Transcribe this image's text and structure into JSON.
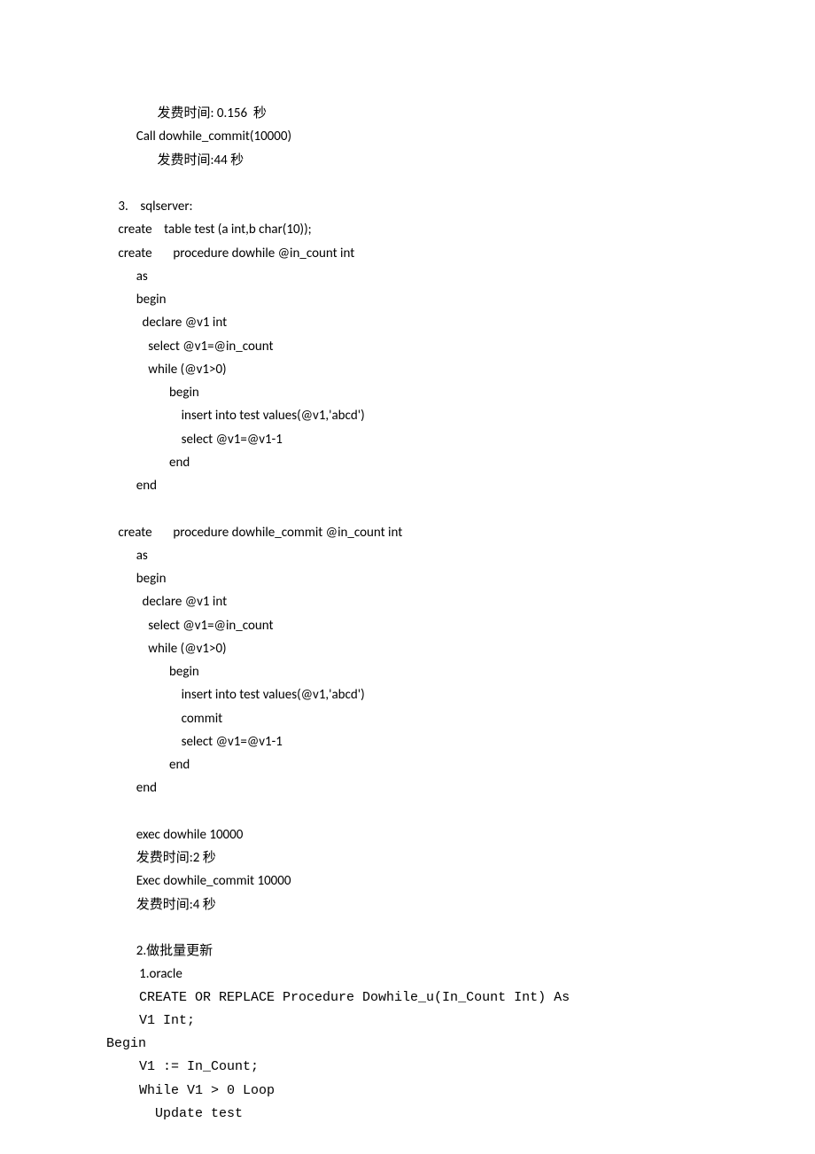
{
  "lines": [
    {
      "text": "              发费时间: 0.156  秒",
      "class": ""
    },
    {
      "text": "       Call dowhile_commit(10000)",
      "class": ""
    },
    {
      "text": "              发费时间:44 秒",
      "class": ""
    },
    {
      "text": " ",
      "class": ""
    },
    {
      "text": " 3.    sqlserver:",
      "class": ""
    },
    {
      "text": " create    table test (a int,b char(10));",
      "class": ""
    },
    {
      "text": " create       procedure dowhile @in_count int",
      "class": ""
    },
    {
      "text": "       as",
      "class": ""
    },
    {
      "text": "       begin",
      "class": ""
    },
    {
      "text": "         declare @v1 int",
      "class": ""
    },
    {
      "text": "           select @v1=@in_count",
      "class": ""
    },
    {
      "text": "           while (@v1>0)",
      "class": ""
    },
    {
      "text": "                  begin",
      "class": ""
    },
    {
      "text": "                      insert into test values(@v1,'abcd')",
      "class": ""
    },
    {
      "text": "                      select @v1=@v1-1",
      "class": ""
    },
    {
      "text": "                  end",
      "class": ""
    },
    {
      "text": "       end",
      "class": ""
    },
    {
      "text": " ",
      "class": ""
    },
    {
      "text": " create       procedure dowhile_commit @in_count int",
      "class": ""
    },
    {
      "text": "       as",
      "class": ""
    },
    {
      "text": "       begin",
      "class": ""
    },
    {
      "text": "         declare @v1 int",
      "class": ""
    },
    {
      "text": "           select @v1=@in_count",
      "class": ""
    },
    {
      "text": "           while (@v1>0)",
      "class": ""
    },
    {
      "text": "                  begin",
      "class": ""
    },
    {
      "text": "                      insert into test values(@v1,'abcd')",
      "class": ""
    },
    {
      "text": "                      commit",
      "class": ""
    },
    {
      "text": "                      select @v1=@v1-1",
      "class": ""
    },
    {
      "text": "                  end",
      "class": ""
    },
    {
      "text": "       end",
      "class": ""
    },
    {
      "text": " ",
      "class": ""
    },
    {
      "text": "       exec dowhile 10000",
      "class": ""
    },
    {
      "text": "       发费时间:2 秒",
      "class": ""
    },
    {
      "text": "       Exec dowhile_commit 10000",
      "class": ""
    },
    {
      "text": "       发费时间:4 秒",
      "class": ""
    },
    {
      "text": " ",
      "class": ""
    },
    {
      "text": "       2.做批量更新",
      "class": ""
    },
    {
      "text": "        1.oracle",
      "class": ""
    },
    {
      "text": "   CREATE OR REPLACE Procedure Dowhile_u(In_Count Int) As",
      "class": "mono"
    },
    {
      "text": "   V1 Int;",
      "class": "mono"
    },
    {
      "text": "Begin",
      "class": "mono nohang"
    },
    {
      "text": "   V1 := In_Count;",
      "class": "mono"
    },
    {
      "text": "   While V1 > 0 Loop",
      "class": "mono"
    },
    {
      "text": "     Update test",
      "class": "mono"
    }
  ]
}
